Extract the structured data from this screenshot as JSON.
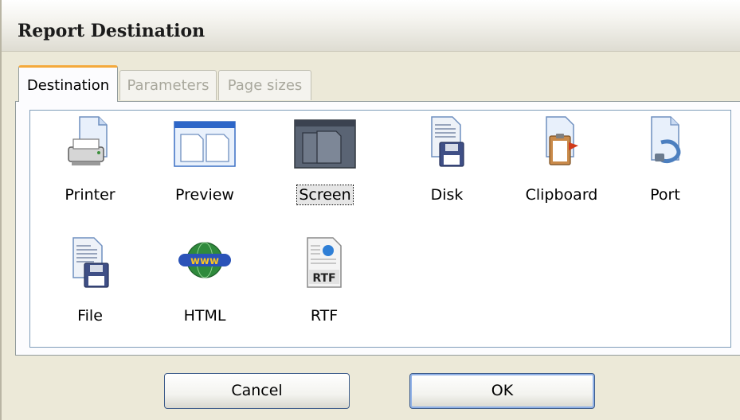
{
  "window": {
    "title": "Report Destination"
  },
  "tabs": [
    {
      "label": "Destination",
      "active": true
    },
    {
      "label": "Parameters",
      "active": false
    },
    {
      "label": "Page sizes",
      "active": false
    }
  ],
  "destinations": [
    {
      "label": "Printer",
      "icon": "printer-icon"
    },
    {
      "label": "Preview",
      "icon": "preview-icon"
    },
    {
      "label": "Screen",
      "icon": "screen-icon",
      "selected": true
    },
    {
      "label": "Disk",
      "icon": "disk-icon"
    },
    {
      "label": "Clipboard",
      "icon": "clipboard-icon"
    },
    {
      "label": "Port",
      "icon": "port-icon"
    },
    {
      "label": "File",
      "icon": "file-icon"
    },
    {
      "label": "HTML",
      "icon": "html-icon",
      "icon_text": "www"
    },
    {
      "label": "RTF",
      "icon": "rtf-icon",
      "icon_text": "RTF"
    }
  ],
  "buttons": {
    "cancel": "Cancel",
    "ok": "OK"
  },
  "colors": {
    "tab_accent": "#f4a93b",
    "selection": "#e6e6e6",
    "button_border": "#3c5b8a"
  }
}
